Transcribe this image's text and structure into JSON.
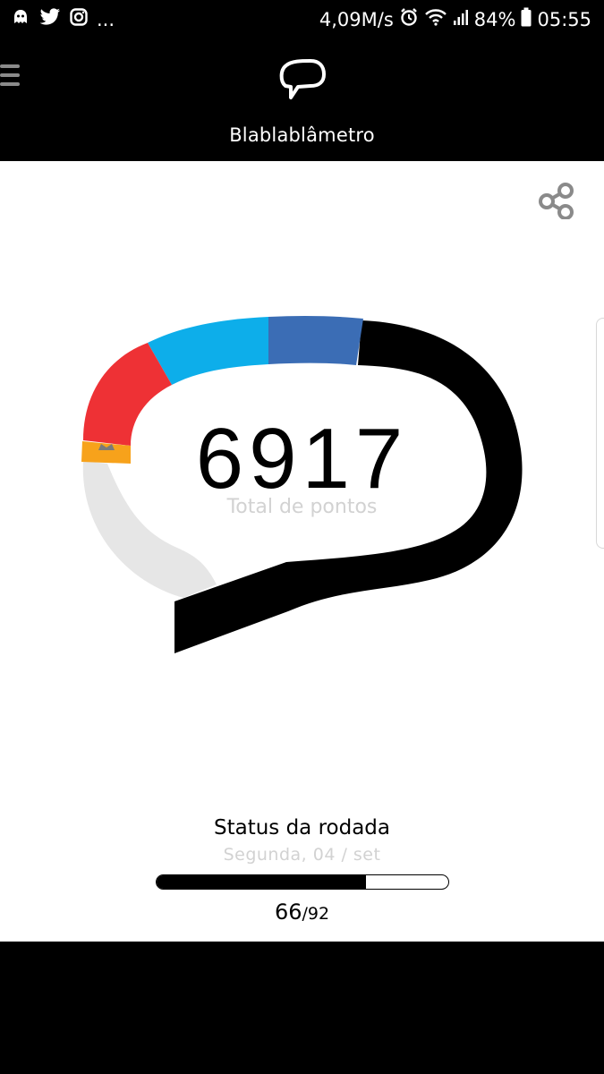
{
  "status_bar": {
    "notifications": [
      "ghost-icon",
      "twitter-icon",
      "instagram-icon"
    ],
    "overflow": "...",
    "net_speed": "4,09M/s",
    "battery": "84%",
    "time": "05:55"
  },
  "header": {
    "title": "Blablablâmetro",
    "menu_icon": "hamburger-menu-icon",
    "logo_icon": "speech-bubble-icon"
  },
  "score": {
    "total": "6917",
    "label": "Total de pontos"
  },
  "round_status": {
    "title": "Status da rodada",
    "date": "Segunda, 04 / set",
    "done": "66",
    "total": "/92",
    "progress_fraction": 0.717
  },
  "colors": {
    "gauge_orange": "#f7a21b",
    "gauge_red": "#ee3135",
    "gauge_light_blue": "#0daeea",
    "gauge_blue": "#3b6db5",
    "gauge_black": "#000000",
    "gauge_empty": "#e6e6e6"
  }
}
